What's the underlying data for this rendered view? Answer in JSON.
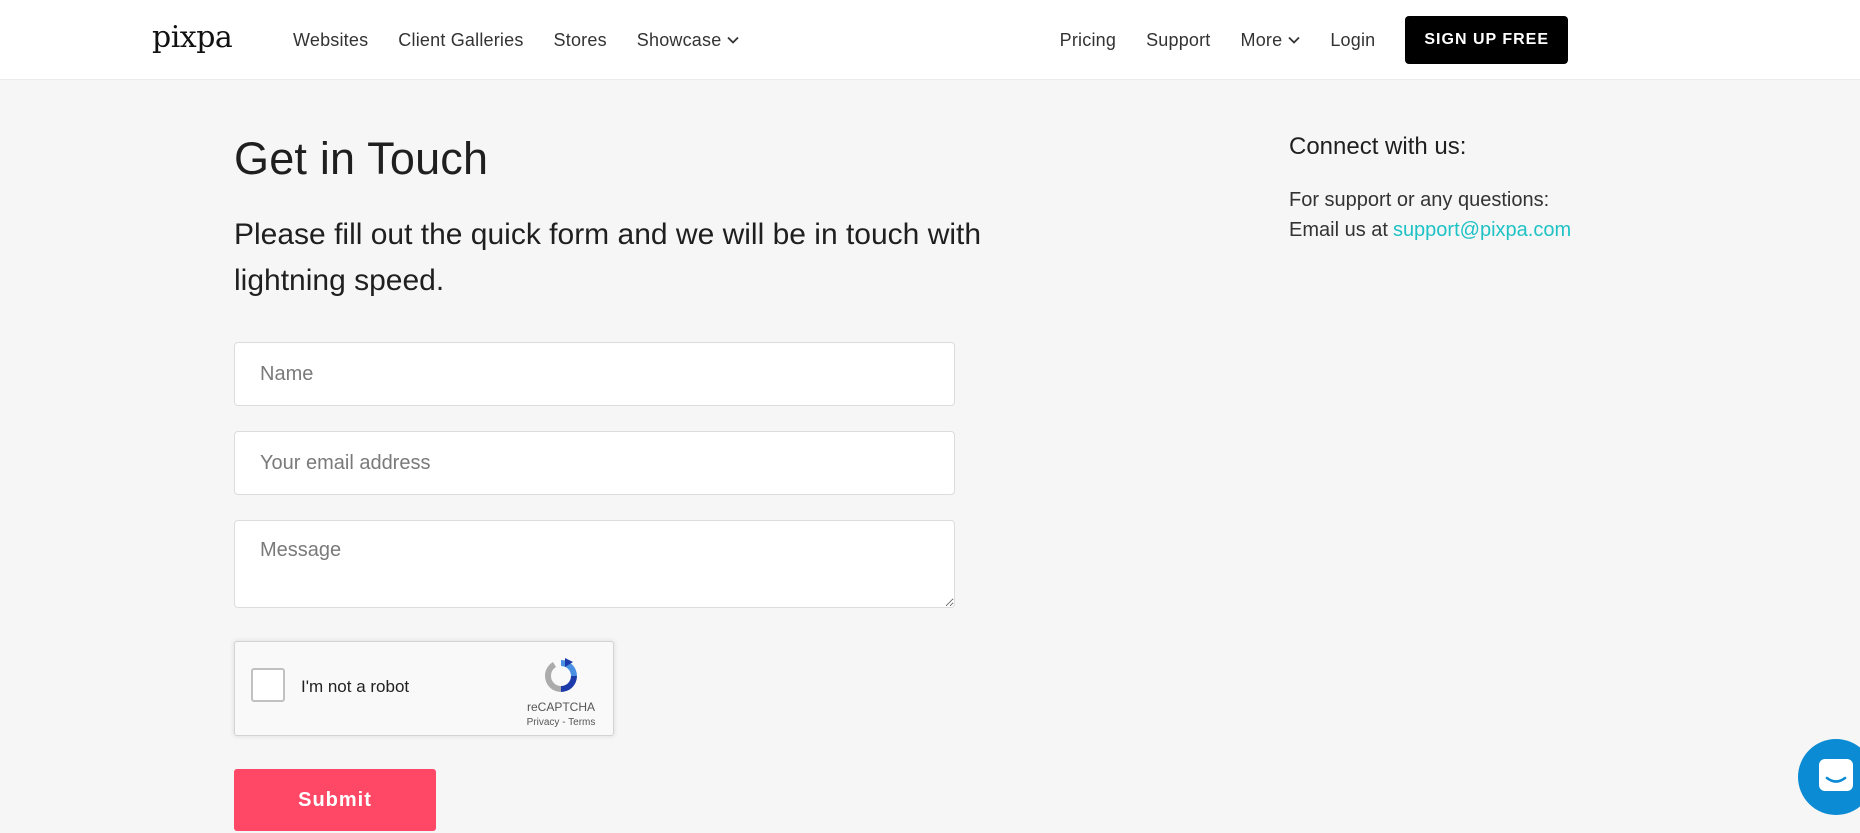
{
  "header": {
    "logo": "pixpa",
    "nav_left": [
      {
        "label": "Websites"
      },
      {
        "label": "Client Galleries"
      },
      {
        "label": "Stores"
      },
      {
        "label": "Showcase"
      }
    ],
    "nav_right": [
      {
        "label": "Pricing"
      },
      {
        "label": "Support"
      },
      {
        "label": "More"
      },
      {
        "label": "Login"
      }
    ],
    "signup_label": "SIGN UP FREE"
  },
  "main": {
    "title": "Get in Touch",
    "subtitle": "Please fill out the quick form and we will be in touch with lightning speed.",
    "form": {
      "name_placeholder": "Name",
      "email_placeholder": "Your email address",
      "message_placeholder": "Message",
      "submit_label": "Submit"
    },
    "recaptcha": {
      "label": "I'm not a robot",
      "brand": "reCAPTCHA",
      "privacy": "Privacy",
      "separator": " - ",
      "terms": "Terms"
    }
  },
  "sidebar": {
    "title": "Connect with us:",
    "line1": "For support or any questions:",
    "line2_prefix": "Email us at",
    "email": "support@pixpa.com"
  },
  "colors": {
    "accent_submit": "#ff4766",
    "link": "#1fc2c5",
    "chat_bubble": "#0b8bd3",
    "background": "#f6f6f6"
  },
  "icons": {
    "chevron": "chevron-down-icon",
    "recaptcha": "recaptcha-logo-icon",
    "chat": "chat-icon"
  }
}
